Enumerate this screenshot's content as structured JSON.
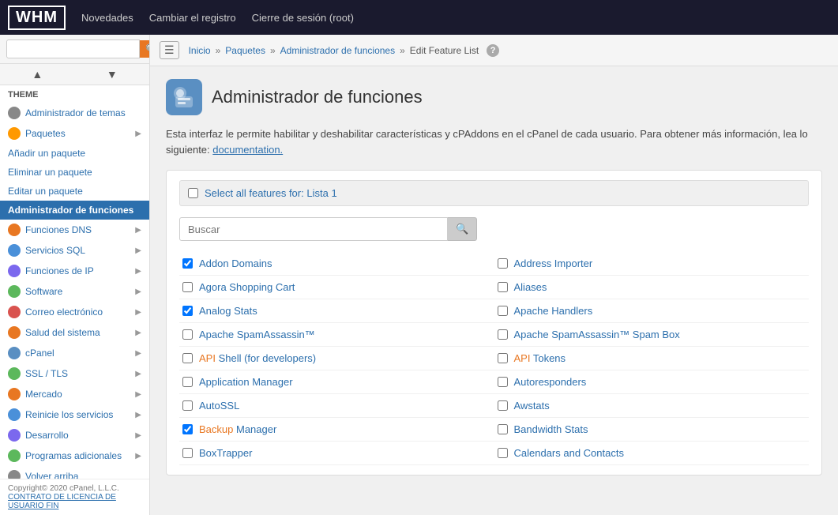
{
  "topNav": {
    "logo": "WHM",
    "links": [
      "Novedades",
      "Cambiar el registro",
      "Cierre de sesión (root)"
    ]
  },
  "sidebar": {
    "searchPlaceholder": "",
    "themeLabel": "Theme",
    "items": [
      {
        "id": "administrador-de-temas",
        "label": "Administrador de temas",
        "icon": "⚙",
        "iconColor": "#888",
        "hasArrow": false
      },
      {
        "id": "paquetes",
        "label": "Paquetes",
        "icon": "📦",
        "iconColor": "#f90",
        "hasArrow": true
      },
      {
        "id": "anadir-paquete",
        "label": "Añadir un paquete",
        "plain": true
      },
      {
        "id": "eliminar-paquete",
        "label": "Eliminar un paquete",
        "plain": true
      },
      {
        "id": "editar-paquete",
        "label": "Editar un paquete",
        "plain": true
      },
      {
        "id": "admin-funciones",
        "label": "Administrador de funciones",
        "active": true
      },
      {
        "id": "funciones-dns",
        "label": "Funciones DNS",
        "icon": "🌐",
        "iconColor": "#e87722",
        "hasArrow": true
      },
      {
        "id": "servicios-sql",
        "label": "Servicios SQL",
        "icon": "🗄",
        "iconColor": "#4a90d9",
        "hasArrow": true
      },
      {
        "id": "funciones-ip",
        "label": "Funciones de IP",
        "icon": "🔌",
        "iconColor": "#7b68ee",
        "hasArrow": true
      },
      {
        "id": "software",
        "label": "Software",
        "icon": "💻",
        "iconColor": "#5cb85c",
        "hasArrow": true
      },
      {
        "id": "correo",
        "label": "Correo electrónico",
        "icon": "✉",
        "iconColor": "#d9534f",
        "hasArrow": true
      },
      {
        "id": "salud",
        "label": "Salud del sistema",
        "icon": "❤",
        "iconColor": "#e87722",
        "hasArrow": true
      },
      {
        "id": "cpanel",
        "label": "cPanel",
        "icon": "⚙",
        "iconColor": "#5a8fc2",
        "hasArrow": true
      },
      {
        "id": "ssl",
        "label": "SSL / TLS",
        "icon": "🔒",
        "iconColor": "#5cb85c",
        "hasArrow": true
      },
      {
        "id": "mercado",
        "label": "Mercado",
        "icon": "🛒",
        "iconColor": "#e87722",
        "hasArrow": true
      },
      {
        "id": "reinicie",
        "label": "Reinicie los servicios",
        "icon": "🔄",
        "iconColor": "#4a90d9",
        "hasArrow": true
      },
      {
        "id": "desarrollo",
        "label": "Desarrollo",
        "icon": "🛠",
        "iconColor": "#7b68ee",
        "hasArrow": true
      },
      {
        "id": "programas",
        "label": "Programas adicionales",
        "icon": "➕",
        "iconColor": "#5cb85c",
        "hasArrow": true
      },
      {
        "id": "volver",
        "label": "Volver arriba",
        "icon": "⬆",
        "iconColor": "#888",
        "hasArrow": false
      }
    ],
    "footer": "Copyright© 2020 cPanel, L.L.C.",
    "footerLink": "CONTRATO DE LICENCIA DE USUARIO FIN"
  },
  "breadcrumb": {
    "items": [
      "Inicio",
      "Paquetes",
      "Administrador de funciones",
      "Edit Feature List"
    ]
  },
  "page": {
    "title": "Administrador de funciones",
    "description": "Esta interfaz le permite habilitar y deshabilitar características y cPAddons en el cPanel de cada usuario. Para obtener más información, lea lo siguiente:",
    "docLink": "documentation.",
    "selectAllLabel": "Select all features for: Lista",
    "selectAllNumber": "1",
    "searchPlaceholder": "Buscar",
    "features": [
      {
        "id": "addon-domains",
        "label": "Addon Domains",
        "checked": true,
        "col": 0
      },
      {
        "id": "address-importer",
        "label": "Address Importer",
        "checked": false,
        "col": 1
      },
      {
        "id": "agora-shopping-cart",
        "label": "Agora Shopping Cart",
        "checked": false,
        "col": 0
      },
      {
        "id": "aliases",
        "label": "Aliases",
        "checked": false,
        "col": 1
      },
      {
        "id": "analog-stats",
        "label": "Analog Stats",
        "checked": true,
        "col": 0
      },
      {
        "id": "apache-handlers",
        "label": "Apache Handlers",
        "checked": false,
        "col": 1
      },
      {
        "id": "apache-spamassassin",
        "label": "Apache SpamAssassin™",
        "checked": false,
        "col": 0
      },
      {
        "id": "apache-spamassassin-spam-box",
        "label": "Apache SpamAssassin™ Spam Box",
        "checked": false,
        "col": 1
      },
      {
        "id": "api-shell",
        "label": "API Shell (for developers)",
        "checked": false,
        "col": 0
      },
      {
        "id": "api-tokens",
        "label": "API Tokens",
        "checked": false,
        "col": 1
      },
      {
        "id": "application-manager",
        "label": "Application Manager",
        "checked": false,
        "col": 0
      },
      {
        "id": "autoresponders",
        "label": "Autoresponders",
        "checked": false,
        "col": 1
      },
      {
        "id": "autossl",
        "label": "AutoSSL",
        "checked": false,
        "col": 0
      },
      {
        "id": "awstats",
        "label": "Awstats",
        "checked": false,
        "col": 1
      },
      {
        "id": "backup-manager",
        "label": "Backup Manager",
        "checked": true,
        "col": 0
      },
      {
        "id": "bandwidth-stats",
        "label": "Bandwidth Stats",
        "checked": false,
        "col": 1
      },
      {
        "id": "boxtrapper",
        "label": "BoxTrapper",
        "checked": false,
        "col": 0
      },
      {
        "id": "calendars-contacts",
        "label": "Calendars and Contacts",
        "checked": false,
        "col": 1
      }
    ]
  }
}
